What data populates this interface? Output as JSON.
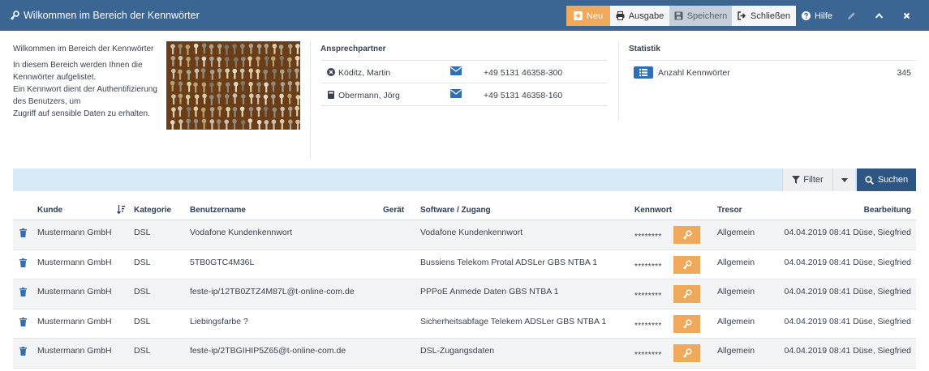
{
  "header": {
    "title": "Wilkommen im Bereich der Kennwörter",
    "buttons": {
      "new": "Neu",
      "output": "Ausgabe",
      "save": "Speichern",
      "close": "Schließen",
      "help": "Hilfe"
    }
  },
  "intro": {
    "heading": "Wilkommen im Bereich der Kennwörter",
    "paragraphs": [
      "In diesem Bereich werden Ihnen die Kennwörter aufgelistet.",
      "Ein Kennwort dient der Authentifizierung des Benutzers, um",
      "Zugriff auf sensible Daten zu erhalten."
    ]
  },
  "contacts": {
    "heading": "Ansprechpartner",
    "items": [
      {
        "name": "Köditz, Martin",
        "phone": "+49 5131 46358-300",
        "icon": "xing-icon"
      },
      {
        "name": "Obermann, Jörg",
        "phone": "+49 5131 46358-160",
        "icon": "book-icon"
      }
    ]
  },
  "stats": {
    "heading": "Statistik",
    "items": [
      {
        "label": "Anzahl Kennwörter",
        "value": "345"
      }
    ]
  },
  "filterbar": {
    "filter_label": "Filter",
    "search_label": "Suchen"
  },
  "table": {
    "columns": {
      "kunde": "Kunde",
      "kategorie": "Kategorie",
      "benutzername": "Benutzername",
      "geraet": "Gerät",
      "software": "Software / Zugang",
      "kennwort": "Kennwort",
      "tresor": "Tresor",
      "bearbeitung": "Bearbeitung"
    },
    "rows": [
      {
        "kunde": "Mustermann GmbH",
        "kategorie": "DSL",
        "benutzername": "Vodafone Kundenkennwort",
        "geraet": "",
        "software": "Vodafone Kundenkennwort",
        "kennwort": "********",
        "tresor": "Allgemein",
        "bearbeitung": "04.04.2019 08:41 Düse, Siegfried"
      },
      {
        "kunde": "Mustermann GmbH",
        "kategorie": "DSL",
        "benutzername": "5TB0GTC4M36L",
        "geraet": "",
        "software": "Bussiens Telekom Protal ADSLer GBS NTBA 1",
        "kennwort": "********",
        "tresor": "Allgemein",
        "bearbeitung": "04.04.2019 08:41 Düse, Siegfried"
      },
      {
        "kunde": "Mustermann GmbH",
        "kategorie": "DSL",
        "benutzername": "feste-ip/12TB0ZTZ4M87L@t-online-com.de",
        "geraet": "",
        "software": "PPPoE Anmede Daten GBS NTBA 1",
        "kennwort": "********",
        "tresor": "Allgemein",
        "bearbeitung": "04.04.2019 08:41 Düse, Siegfried"
      },
      {
        "kunde": "Mustermann GmbH",
        "kategorie": "DSL",
        "benutzername": "Liebingsfarbe ?",
        "geraet": "",
        "software": "Sicherheitsabfage Telekem ADSLer GBS NTBA 1",
        "kennwort": "********",
        "tresor": "Allgemein",
        "bearbeitung": "04.04.2019 08:41 Düse, Siegfried"
      },
      {
        "kunde": "Mustermann GmbH",
        "kategorie": "DSL",
        "benutzername": "feste-ip/2TBGIHIP5Z65@t-online-com.de",
        "geraet": "",
        "software": "DSL-Zugangsdaten",
        "kennwort": "********",
        "tresor": "Allgemein",
        "bearbeitung": "04.04.2019 08:41 Düse, Siegfried"
      }
    ]
  },
  "colors": {
    "header_bg": "#3b6593",
    "accent_orange": "#f0a85a",
    "search_btn": "#2e5683",
    "filterbar_bg": "#d8eaf5",
    "badge_blue": "#2f6fb3"
  }
}
